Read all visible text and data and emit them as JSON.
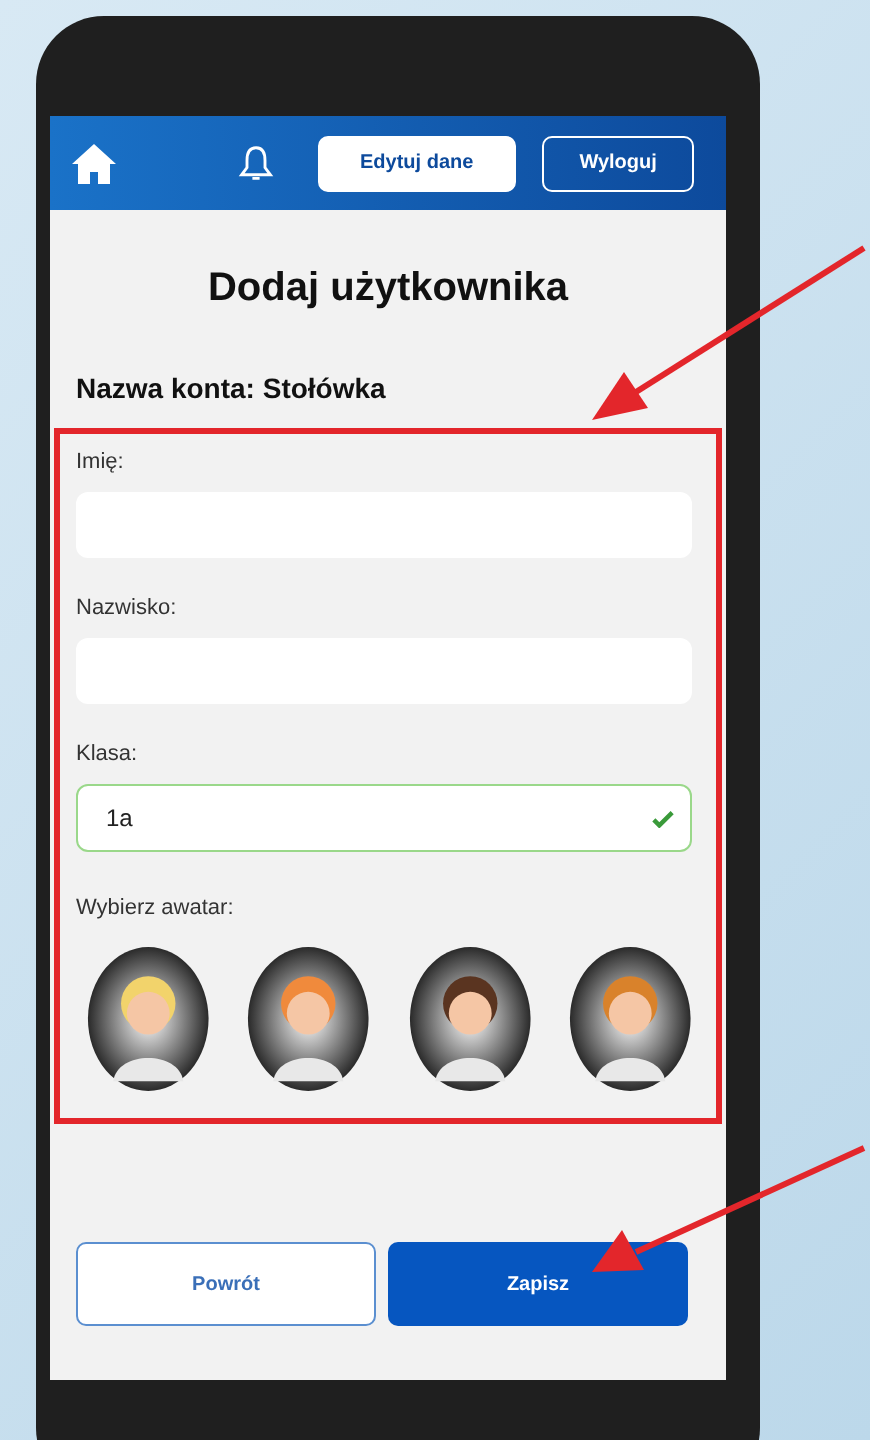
{
  "header": {
    "buttons": [
      {
        "label": "Edytuj dane",
        "selected": true
      },
      {
        "label": "Wyloguj",
        "selected": false
      }
    ]
  },
  "title": "Dodaj użytkownika",
  "account_label": "Nazwa konta: Stołówka",
  "fields": [
    {
      "label": "Imię:",
      "valid": false
    },
    {
      "label": "Nazwisko:",
      "valid": false
    },
    {
      "label": "Klasa:",
      "value": "1a",
      "valid": true
    }
  ],
  "avatar_label": "Wybierz awatar:",
  "avatars": [
    {
      "color": "#f2d36b"
    },
    {
      "color": "#f08a3c"
    },
    {
      "color": "#5a3420"
    },
    {
      "color": "#d9822b"
    }
  ],
  "buttons": [
    {
      "label": "Powrót",
      "kind": "secondary"
    },
    {
      "label": "Zapisz",
      "kind": "primary"
    }
  ]
}
